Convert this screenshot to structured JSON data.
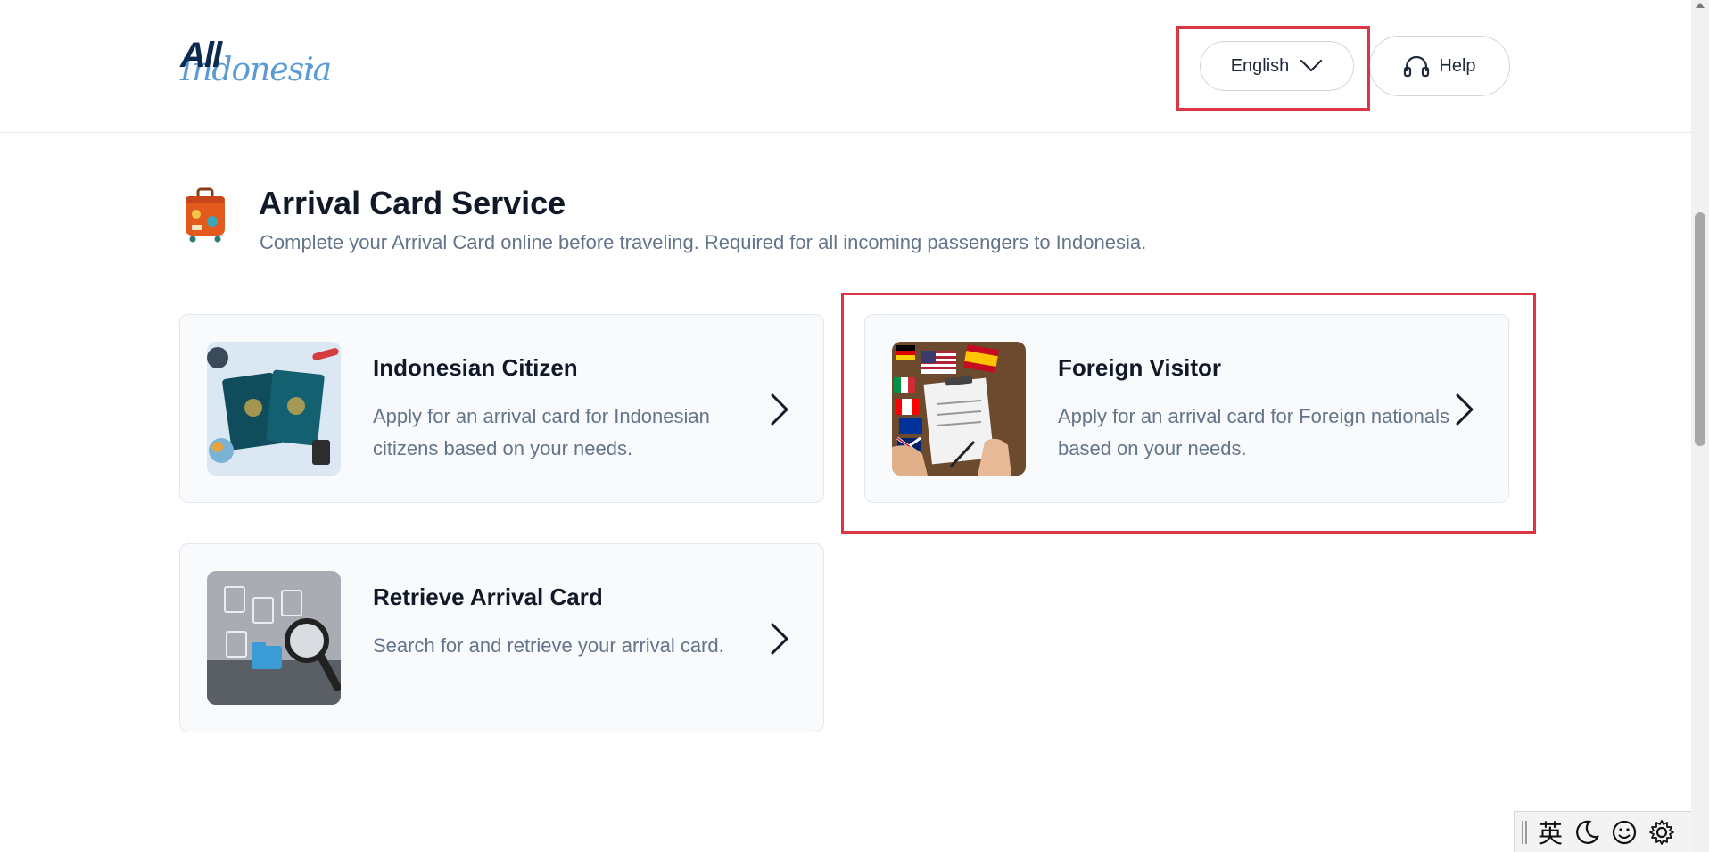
{
  "header": {
    "logo": {
      "line1": "All",
      "line2": "Indonesia"
    },
    "language_button": {
      "label": "English"
    },
    "help_button": {
      "label": "Help"
    }
  },
  "main": {
    "title": "Arrival Card Service",
    "subtitle": "Complete your Arrival Card online before traveling. Required for all incoming passengers to Indonesia.",
    "cards": [
      {
        "title": "Indonesian Citizen",
        "description": "Apply for an arrival card for Indonesian citizens based on your needs."
      },
      {
        "title": "Foreign Visitor",
        "description": "Apply for an arrival card for Foreign nationals based on your needs."
      },
      {
        "title": "Retrieve Arrival Card",
        "description": "Search for and retrieve your arrival card."
      }
    ]
  },
  "ime_toolbar": {
    "mode": "英"
  },
  "colors": {
    "highlight": "#dc3545",
    "brand_navy": "#0c2a4d",
    "brand_blue": "#5b9bd5",
    "card_bg": "#f8fafc"
  }
}
